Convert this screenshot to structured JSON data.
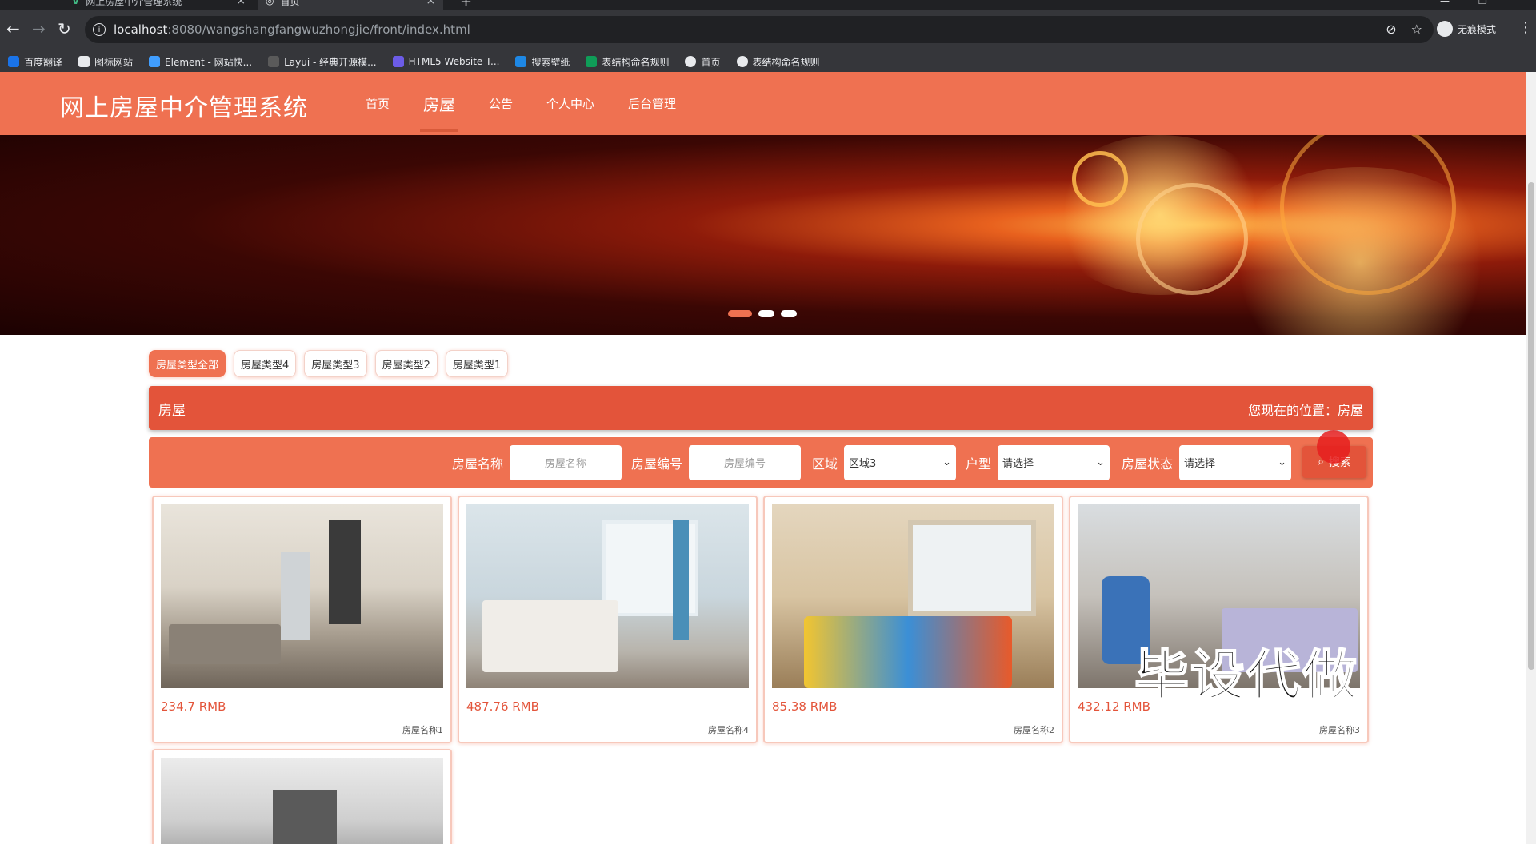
{
  "browser": {
    "tabs": [
      {
        "title": "网上房屋中介管理系统",
        "active": false
      },
      {
        "title": "首页",
        "active": true
      }
    ],
    "url_host": "localhost",
    "url_path": ":8080/wangshangfangwuzhongjie/front/index.html",
    "profile_label": "无痕模式",
    "bookmarks": [
      "百度翻译",
      "图标网站",
      "Element - 网站快...",
      "Layui - 经典开源模...",
      "HTML5 Website T...",
      "搜索壁纸",
      "表结构命名规则",
      "首页",
      "表结构命名规则"
    ]
  },
  "site": {
    "title": "网上房屋中介管理系统",
    "nav": [
      "首页",
      "房屋",
      "公告",
      "个人中心",
      "后台管理"
    ],
    "active_nav": "房屋",
    "brand_color": "#ef7151"
  },
  "banner": {
    "slides": 3,
    "active_slide": 1
  },
  "filters": [
    "房屋类型全部",
    "房屋类型4",
    "房屋类型3",
    "房屋类型2",
    "房屋类型1"
  ],
  "crumb": {
    "left": "房屋",
    "right": "您现在的位置：房屋"
  },
  "search": {
    "name_label": "房屋名称",
    "name_placeholder": "房屋名称",
    "code_label": "房屋编号",
    "code_placeholder": "房屋编号",
    "area_label": "区域",
    "area_value": "区域3",
    "type_label": "户型",
    "type_value": "请选择",
    "status_label": "房屋状态",
    "status_value": "请选择",
    "button_label": "搜索"
  },
  "listings": [
    {
      "price": "234.7 RMB",
      "name": "房屋名称1"
    },
    {
      "price": "487.76 RMB",
      "name": "房屋名称4"
    },
    {
      "price": "85.38 RMB",
      "name": "房屋名称2"
    },
    {
      "price": "432.12 RMB",
      "name": "房屋名称3"
    }
  ],
  "watermark": "毕设代做"
}
